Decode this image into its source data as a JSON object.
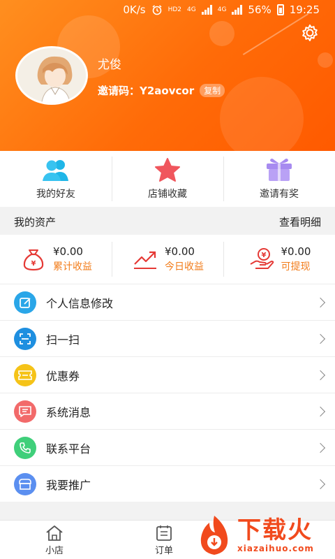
{
  "status_bar": {
    "speed": "0K/s",
    "network_hd": "HD2",
    "network_4g": "4G",
    "battery": "56%",
    "time": "19:25"
  },
  "profile": {
    "name": "尤俊",
    "invite_label": "邀请码：Y2aovcor",
    "copy_label": "复制"
  },
  "quick_actions": [
    {
      "label": "我的好友",
      "icon": "friends-icon"
    },
    {
      "label": "店铺收藏",
      "icon": "star-icon"
    },
    {
      "label": "邀请有奖",
      "icon": "gift-icon"
    }
  ],
  "assets": {
    "title": "我的资产",
    "detail_link": "查看明细",
    "items": [
      {
        "amount": "¥0.00",
        "label": "累计收益",
        "icon": "money-bag-icon"
      },
      {
        "amount": "¥0.00",
        "label": "今日收益",
        "icon": "trend-up-icon"
      },
      {
        "amount": "¥0.00",
        "label": "可提现",
        "icon": "cash-hand-icon"
      }
    ]
  },
  "menu": [
    {
      "label": "个人信息修改",
      "icon": "edit-icon",
      "color": "#2aa6e8"
    },
    {
      "label": "扫一扫",
      "icon": "scan-icon",
      "color": "#1e8fe0"
    },
    {
      "label": "优惠券",
      "icon": "coupon-icon",
      "color": "#f5c318"
    },
    {
      "label": "系统消息",
      "icon": "message-icon",
      "color": "#f26a6a"
    },
    {
      "label": "联系平台",
      "icon": "phone-icon",
      "color": "#3fcf7a"
    },
    {
      "label": "我要推广",
      "icon": "promote-icon",
      "color": "#5b8ff0"
    }
  ],
  "bottom_nav": [
    {
      "label": "小店",
      "icon": "home-icon"
    },
    {
      "label": "订单",
      "icon": "order-icon"
    }
  ],
  "watermark": {
    "brand": "下载火",
    "url": "xiazaihuo.com"
  }
}
